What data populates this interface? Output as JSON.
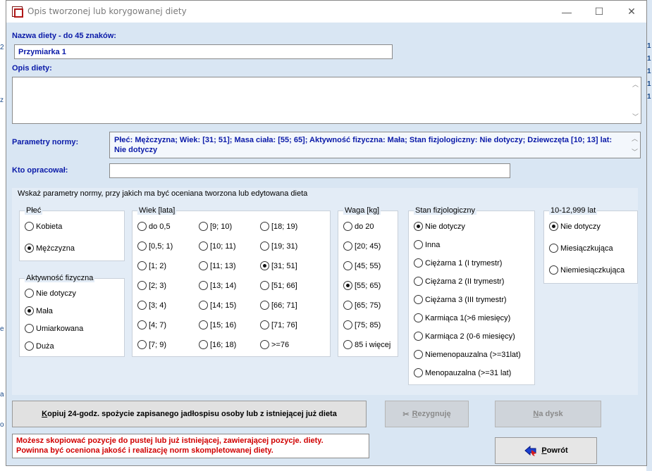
{
  "window": {
    "title": "Opis tworzonej lub korygowanej diety",
    "minimize": "—",
    "maximize": "☐",
    "close": "✕"
  },
  "diet_name": {
    "label": "Nazwa diety - do 45 znaków:",
    "value": "Przymiarka 1"
  },
  "diet_description": {
    "label": "Opis diety:",
    "value": ""
  },
  "norm_params": {
    "label": "Parametry normy:",
    "line1": "Płeć: Mężczyzna; Wiek: [31; 51]; Masa ciała: [55; 65]; Aktywność fizyczna: Mała; Stan fizjologiczny: Nie dotyczy; Dziewczęta [10; 13] lat:",
    "line2": "Nie dotyczy"
  },
  "author": {
    "label": "Kto opracował:",
    "value": ""
  },
  "panel_title": "Wskaż parametry normy, przy jakich ma być oceniana tworzona lub edytowana  dieta",
  "sex": {
    "title": "Płeć",
    "options": [
      {
        "label": "Kobieta",
        "selected": false
      },
      {
        "label": "Mężczyzna",
        "selected": true
      }
    ]
  },
  "activity": {
    "title": "Aktywność fizyczna",
    "options": [
      {
        "label": "Nie dotyczy",
        "selected": false
      },
      {
        "label": "Mała",
        "selected": true
      },
      {
        "label": "Umiarkowana",
        "selected": false
      },
      {
        "label": "Duża",
        "selected": false
      }
    ]
  },
  "age": {
    "title": "Wiek [lata]",
    "options": [
      "do 0,5",
      "[0,5; 1)",
      "[1; 2)",
      "[2; 3)",
      "[3; 4)",
      "[4; 7)",
      "[7; 9)",
      "[9; 10)",
      "[10; 11)",
      "[11; 13)",
      "[13; 14)",
      "[14; 15)",
      "[15; 16)",
      "[16; 18)",
      "[18; 19)",
      "[19; 31)",
      "[31; 51]",
      "[51; 66]",
      "[66; 71]",
      "[71; 76]",
      ">=76"
    ],
    "selected": "[31; 51]"
  },
  "weight": {
    "title": "Waga [kg]",
    "options": [
      "do 20",
      "[20; 45)",
      "[45; 55)",
      "[55; 65)",
      "[65; 75)",
      "[75; 85)",
      "85 i więcej"
    ],
    "selected": "[55; 65)"
  },
  "physio": {
    "title": "Stan fizjologiczny",
    "options": [
      "Nie dotyczy",
      "Inna",
      "Ciężarna 1 (I trymestr)",
      "Ciężarna 2 (II trymestr)",
      "Ciężarna 3 (III trymestr)",
      "Karmiąca 1(>6 miesięcy)",
      "Karmiąca 2 (0-6 miesięcy)",
      "Niemenopauzalna (>=31lat)",
      "Menopauzalna (>=31 lat)"
    ],
    "selected": "Nie dotyczy"
  },
  "girls": {
    "title": "10-12,999 lat",
    "options": [
      "Nie dotyczy",
      "Miesiączkująca",
      "Niemiesiączkująca"
    ],
    "selected": "Nie dotyczy"
  },
  "buttons": {
    "copy_key": "K",
    "copy_rest": "opiuj 24-godz. spożycie zapisanego jadłospisu osoby lub z istniejącej już  dieta",
    "cancel_key": "R",
    "cancel_rest": "ezygnuję",
    "save_key": "N",
    "save_rest": "a dysk",
    "return_key": "P",
    "return_rest": "owrót"
  },
  "warning": {
    "line1": "Możesz skopiować pozycje do pustej lub już istniejącej, zawierającej pozycje. diety.",
    "line2": "Powinna być oceniona jakość i realizację norm skompletowanej diety."
  },
  "colors": {
    "window_bg": "#d9e6f3",
    "label_blue": "#0a1aa8",
    "warning_red": "#d00000"
  }
}
